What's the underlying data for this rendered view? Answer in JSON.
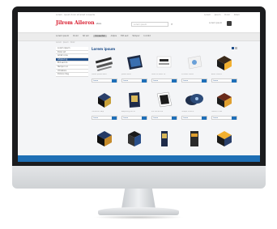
{
  "header": {
    "top_left": "Lorem · Ipsum dolor sit amet consecte",
    "top_right": "Lorem Ipsum Dolor Sitam",
    "logo": "Jilrom Aileron",
    "logo_tag": "store",
    "search_placeholder": "Lorem ipsum",
    "account": "Lorem ipsum"
  },
  "nav": {
    "items": [
      "Lorem ipsum",
      "Dolor",
      "Sit am",
      "Consectet",
      "Adipis",
      "Elit sed",
      "Tempor",
      "Incidid"
    ],
    "active_index": 3
  },
  "breadcrumb": "Lorem · Ipsum · Dolor",
  "sidebar": {
    "items": [
      "Lorem ipsum",
      "Dolor sit",
      "Amet cons",
      "Adipiscing",
      "Elit sed do",
      "Tempor inc",
      "Ut labore",
      "Dolore mag"
    ],
    "active_index": 3
  },
  "main": {
    "title": "Lorem ipsum",
    "products": [
      {
        "name": "Lorem ipsum dolor",
        "cta": "Lorem"
      },
      {
        "name": "Ipsum dolor",
        "cta": "Lorem"
      },
      {
        "name": "Dolor sit amet co",
        "cta": "Lorem"
      },
      {
        "name": "Sit amet conse",
        "cta": "Lorem"
      },
      {
        "name": "Amet consec",
        "cta": "Lorem"
      },
      {
        "name": "Consectet adip",
        "cta": "Lorem"
      },
      {
        "name": "Adipiscing elit se",
        "cta": "Lorem"
      },
      {
        "name": "Elit sed do eiu",
        "cta": "Lorem"
      },
      {
        "name": "Tempor incid ut",
        "cta": "Lorem"
      },
      {
        "name": "Labore et dol",
        "cta": "Lorem"
      },
      {
        "name": "",
        "cta": ""
      },
      {
        "name": "",
        "cta": ""
      },
      {
        "name": "",
        "cta": ""
      },
      {
        "name": "",
        "cta": ""
      },
      {
        "name": "",
        "cta": ""
      }
    ]
  },
  "colors": {
    "brand_red": "#d8192b",
    "accent_blue": "#1f4f8b",
    "button_blue": "#1f6fb8"
  }
}
